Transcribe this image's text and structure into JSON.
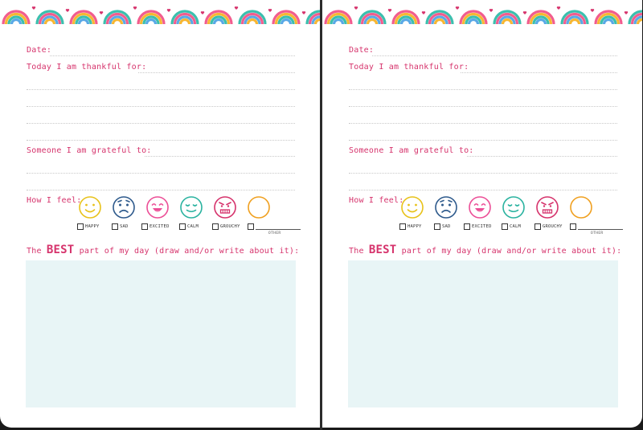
{
  "pages": [
    {
      "date_label": "Date:",
      "thankful_label": "Today I am thankful for:",
      "grateful_label": "Someone I am grateful to:",
      "feel_label": "How I feel:",
      "moods": [
        "HAPPY",
        "SAD",
        "EXCITED",
        "CALM",
        "GROUCHY"
      ],
      "other_label": "OTHER",
      "best_prefix": "The ",
      "best_word": "BEST",
      "best_suffix": " part of my day (draw and/or write about it):"
    },
    {
      "date_label": "Date:",
      "thankful_label": "Today I am thankful for:",
      "grateful_label": "Someone I am grateful to:",
      "feel_label": "How I feel:",
      "moods": [
        "HAPPY",
        "SAD",
        "EXCITED",
        "CALM",
        "GROUCHY"
      ],
      "other_label": "OTHER",
      "best_prefix": "The ",
      "best_word": "BEST",
      "best_suffix": " part of my day (draw and/or write about it):"
    }
  ],
  "colors": {
    "label_pink": "#d6336c",
    "happy": "#e8c21a",
    "sad": "#2e5a8c",
    "excited": "#ec4f97",
    "calm": "#2bb3a0",
    "grouchy": "#d6336c",
    "other": "#f0a020",
    "draw_box": "#e8f5f6"
  },
  "icons": {
    "banner": "rainbow-icon",
    "faces": [
      "happy-face-icon",
      "sad-face-icon",
      "excited-face-icon",
      "calm-face-icon",
      "grouchy-face-icon",
      "blank-face-icon"
    ]
  }
}
